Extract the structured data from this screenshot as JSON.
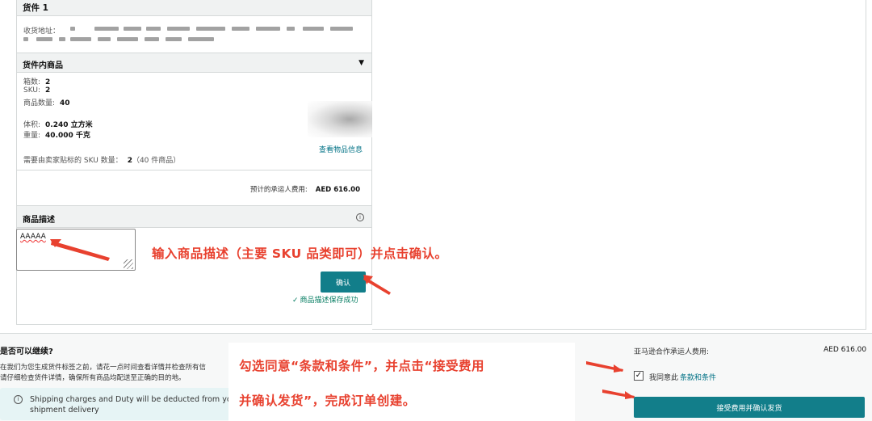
{
  "shipment": {
    "title": "货件 1",
    "address_label": "收货地址：",
    "contents_title": "货件内商品",
    "boxes_label": "箱数:",
    "boxes_value": "2",
    "sku_label": "SKU:",
    "sku_value": "2",
    "units_label": "商品数量:",
    "units_value": "40",
    "volume_label": "体积:",
    "volume_value": "0.240 立方米",
    "weight_label": "重量:",
    "weight_value": "40.000 千克",
    "view_items_link": "查看物品信息",
    "seller_label_text": "需要由卖家贴标的 SKU 数量：",
    "seller_label_count": "2",
    "seller_label_units": "（40 件商品）",
    "carrier_fee_label": "预计的承运人费用:",
    "carrier_fee_value": "AED 616.00"
  },
  "description": {
    "title": "商品描述",
    "input_value": "AAAAA",
    "confirm_label": "确认",
    "saved_message": "商品描述保存成功",
    "check_icon": "✓"
  },
  "annotations": {
    "step1": "输入商品描述（主要 SKU 品类即可）并点击确认。",
    "step2_line1": "勾选同意“条款和条件”，并点击“接受费用",
    "step2_line2": "并确认发货”，完成订单创建。",
    "color": "#e8412f"
  },
  "proceed": {
    "title": "是否可以继续?",
    "line1": "在我们为您生成货件标签之前，请花一点时间查看详情并检查所有信",
    "line2": "请仔细检查货件详情，确保所有商品均配送至正确的目的地。",
    "notice_line1": "Shipping charges and Duty will be deducted from yo",
    "notice_line2": "shipment delivery"
  },
  "summary": {
    "partner_fee_label": "亚马逊合作承运人费用:",
    "partner_fee_value": "AED 616.00",
    "agree_prefix": "我同意此",
    "agree_link": "条款和条件",
    "accept_button": "接受费用并确认发货",
    "checked": true
  },
  "colors": {
    "primary_button": "#127e8a",
    "link": "#007185",
    "success": "#067d62"
  }
}
